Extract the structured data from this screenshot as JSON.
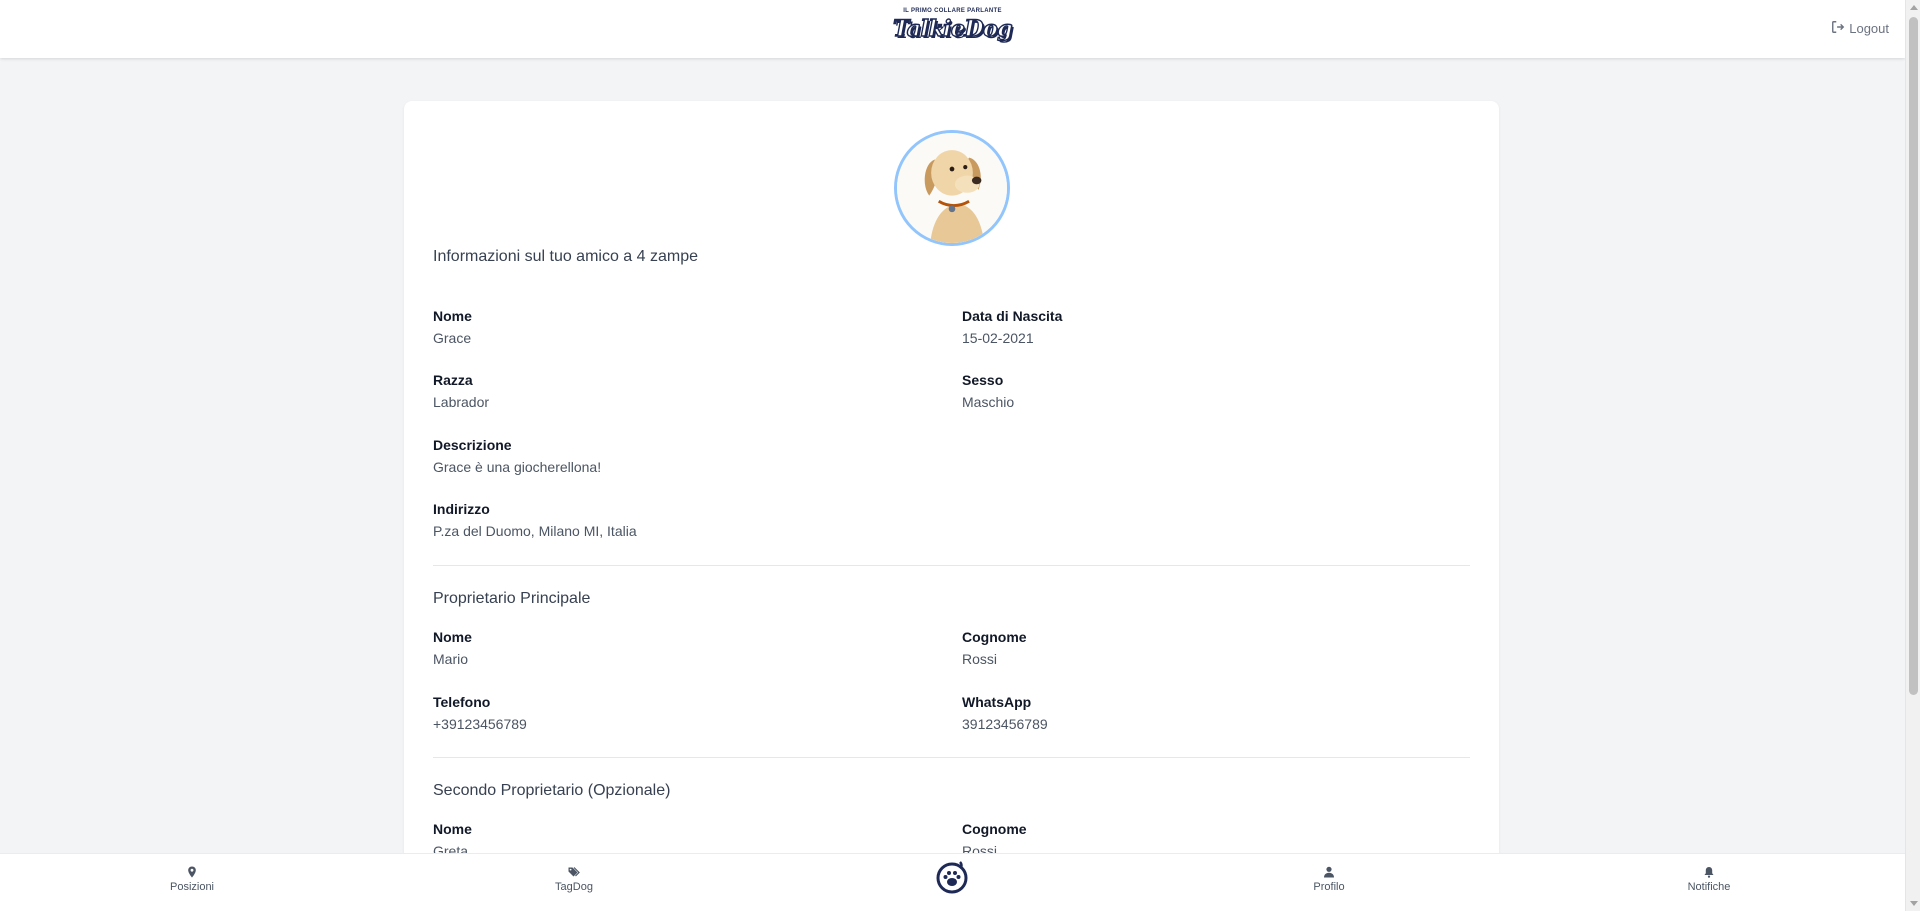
{
  "header": {
    "tagline": "IL PRIMO COLLARE PARLANTE",
    "logo_text": "TalkieDog",
    "logout_label": "Logout"
  },
  "pet_section": {
    "title": "Informazioni sul tuo amico a 4 zampe",
    "fields": [
      {
        "label": "Nome",
        "value": "Grace"
      },
      {
        "label": "Data di Nascita",
        "value": "15-02-2021"
      },
      {
        "label": "Razza",
        "value": "Labrador"
      },
      {
        "label": "Sesso",
        "value": "Maschio"
      },
      {
        "label": "Descrizione",
        "value": "Grace è una giocherellona!"
      },
      {
        "label": "Indirizzo",
        "value": "P.za del Duomo, Milano MI, Italia"
      }
    ]
  },
  "owner_section": {
    "title": "Proprietario Principale",
    "fields": [
      {
        "label": "Nome",
        "value": "Mario"
      },
      {
        "label": "Cognome",
        "value": "Rossi"
      },
      {
        "label": "Telefono",
        "value": "+39123456789"
      },
      {
        "label": "WhatsApp",
        "value": "39123456789"
      }
    ]
  },
  "second_owner_section": {
    "title": "Secondo Proprietario (Opzionale)",
    "fields": [
      {
        "label": "Nome",
        "value": "Greta"
      },
      {
        "label": "Cognome",
        "value": "Rossi"
      }
    ]
  },
  "bottom_nav": {
    "items": [
      {
        "label": "Posizioni",
        "icon": "location-pin-icon"
      },
      {
        "label": "TagDog",
        "icon": "tags-icon"
      },
      {
        "label": "",
        "icon": "paw-center-icon"
      },
      {
        "label": "Profilo",
        "icon": "user-icon"
      },
      {
        "label": "Notifiche",
        "icon": "bell-icon"
      }
    ]
  },
  "colors": {
    "brand_navy": "#1e2a55",
    "avatar_ring": "#93c5fd",
    "background": "#f3f4f6"
  }
}
